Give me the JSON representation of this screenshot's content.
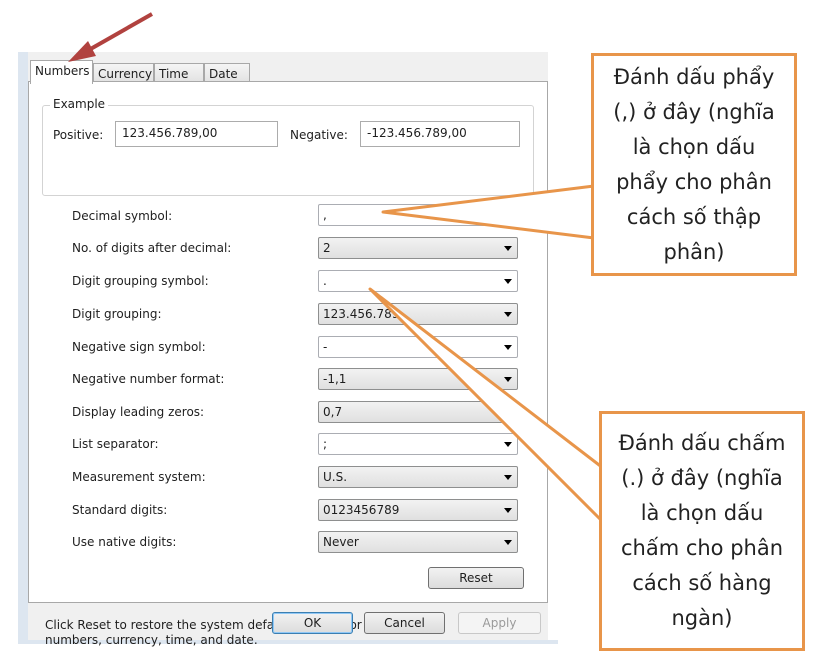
{
  "tabs": [
    "Numbers",
    "Currency",
    "Time",
    "Date"
  ],
  "example": {
    "title": "Example",
    "positive_label": "Positive:",
    "positive_value": "123.456.789,00",
    "negative_label": "Negative:",
    "negative_value": "-123.456.789,00"
  },
  "settings": [
    {
      "label": "Decimal symbol:",
      "value": ",",
      "kind": "edit"
    },
    {
      "label": "No. of digits after decimal:",
      "value": "2",
      "kind": "drop"
    },
    {
      "label": "Digit grouping symbol:",
      "value": ".",
      "kind": "edit"
    },
    {
      "label": "Digit grouping:",
      "value": "123.456.789",
      "kind": "drop"
    },
    {
      "label": "Negative sign symbol:",
      "value": "-",
      "kind": "edit"
    },
    {
      "label": "Negative number format:",
      "value": "-1,1",
      "kind": "drop"
    },
    {
      "label": "Display leading zeros:",
      "value": "0,7",
      "kind": "drop"
    },
    {
      "label": "List separator:",
      "value": ";",
      "kind": "edit"
    },
    {
      "label": "Measurement system:",
      "value": "U.S.",
      "kind": "drop"
    },
    {
      "label": "Standard digits:",
      "value": "0123456789",
      "kind": "drop"
    },
    {
      "label": "Use native digits:",
      "value": "Never",
      "kind": "drop"
    }
  ],
  "reset_note": "Click Reset to restore the system default settings for numbers, currency, time, and date.",
  "buttons": {
    "reset": "Reset",
    "ok": "OK",
    "cancel": "Cancel",
    "apply": "Apply"
  },
  "callouts": {
    "decimal": "Đánh dấu phẩy (,) ở đây (nghĩa là chọn dấu phẩy cho phân cách số thập phân)",
    "grouping": "Đánh dấu chấm (.) ở đây (nghĩa là chọn dấu chấm cho phân cách số hàng ngàn)"
  },
  "colors": {
    "arrow": "#b1423f",
    "callout_border": "#e8954a",
    "default_button_border": "#3c7fb1"
  }
}
